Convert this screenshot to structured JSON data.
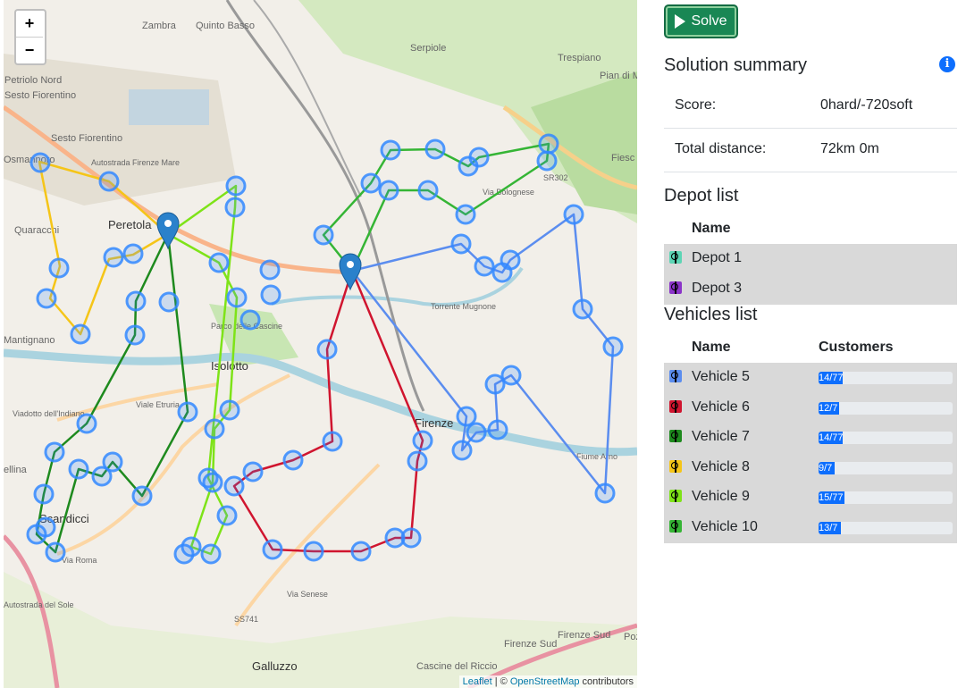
{
  "map": {
    "zoom_in": "+",
    "zoom_out": "−",
    "attribution_leaflet": "Leaflet",
    "attribution_sep": " | © ",
    "attribution_osm": "OpenStreetMap",
    "attribution_suffix": " contributors",
    "place_labels": [
      "Zambra",
      "Quinto Basso",
      "Serpiole",
      "Trespiano",
      "Pian di M",
      "Fiesc",
      "Petriolo Nord",
      "Sesto Fiorentino",
      "Sesto Fiorentino",
      "Osmannoro",
      "Peretola",
      "Quaracchi",
      "Mantignano",
      "Isolotto",
      "Firenze",
      "Scandicci",
      "Galluzzo",
      "Cascine del Riccio",
      "Firenze Sud",
      "Firenze Sud",
      "Pozzo",
      "ellina",
      "Parco delle Cascine",
      "Torrente Mugnone",
      "Fiume Arno",
      "Viadotto dell'Indiano",
      "SR302",
      "SS741",
      "Via Senese",
      "Via Roma",
      "Viale Etruria",
      "Via Bolognese",
      "Autostrada del Sole",
      "Autostrada Firenze Mare"
    ],
    "colors": {
      "vehicle_5": "#5b8def",
      "vehicle_6": "#d0152f",
      "vehicle_7": "#1e8a1e",
      "vehicle_8": "#f5c518",
      "vehicle_9": "#7ee318",
      "vehicle_10": "#35b535",
      "marker": "#2a81cb",
      "stop_fill": "#3388ff"
    }
  },
  "panel": {
    "solve_label": "Solve",
    "summary_title": "Solution summary",
    "score_label": "Score:",
    "score_value": "0hard/-720soft",
    "distance_label": "Total distance:",
    "distance_value": "72km 0m",
    "depot_title": "Depot list",
    "depot_name_header": "Name",
    "depots": [
      {
        "name": "Depot 1",
        "color": "#5dd5b5"
      },
      {
        "name": "Depot 3",
        "color": "#8b34c9"
      }
    ],
    "vehicles_title": "Vehicles list",
    "vehicles_name_header": "Name",
    "vehicles_customers_header": "Customers",
    "vehicles": [
      {
        "name": "Vehicle 5",
        "color": "#5b8def",
        "customers": "14/77",
        "fill_fraction": 0.182
      },
      {
        "name": "Vehicle 6",
        "color": "#d0152f",
        "customers": "12/7",
        "fill_fraction": 0.156
      },
      {
        "name": "Vehicle 7",
        "color": "#1e8a1e",
        "customers": "14/77",
        "fill_fraction": 0.182
      },
      {
        "name": "Vehicle 8",
        "color": "#f5c518",
        "customers": "9/7",
        "fill_fraction": 0.117
      },
      {
        "name": "Vehicle 9",
        "color": "#7ee318",
        "customers": "15/77",
        "fill_fraction": 0.195
      },
      {
        "name": "Vehicle 10",
        "color": "#35b535",
        "customers": "13/7",
        "fill_fraction": 0.169
      }
    ]
  }
}
